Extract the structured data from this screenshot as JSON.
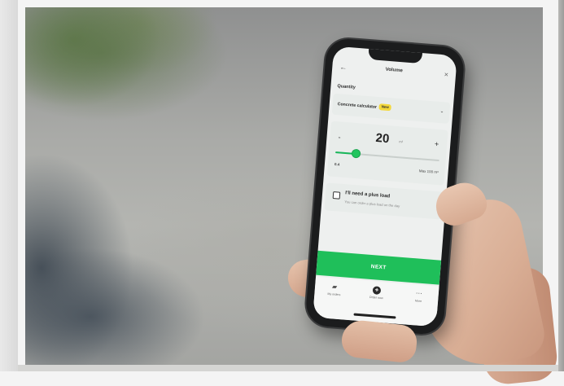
{
  "screen": {
    "title": "Volume",
    "back_icon": "arrow-left-icon",
    "close_icon": "close-icon"
  },
  "quantity": {
    "section_label": "Quantity",
    "calculator_label": "Concrete calculator",
    "badge": "New"
  },
  "volume": {
    "minus": "-",
    "plus": "+",
    "value": "20",
    "unit": "m³",
    "min_label": "0.4",
    "max_label": "Max 100 m³",
    "slider_fraction": 0.2
  },
  "plus_load": {
    "label": "I'll need a plus load",
    "sub": "You can order a plus load on the day",
    "checked": false
  },
  "next_button": "NEXT",
  "tabbar": {
    "items": [
      {
        "label": "My orders",
        "icon": "truck-icon"
      },
      {
        "label": "Order now",
        "icon": "add-icon"
      },
      {
        "label": "More",
        "icon": "more-icon"
      }
    ]
  },
  "colors": {
    "accent": "#1fbf5a",
    "badge": "#f4d83a"
  }
}
